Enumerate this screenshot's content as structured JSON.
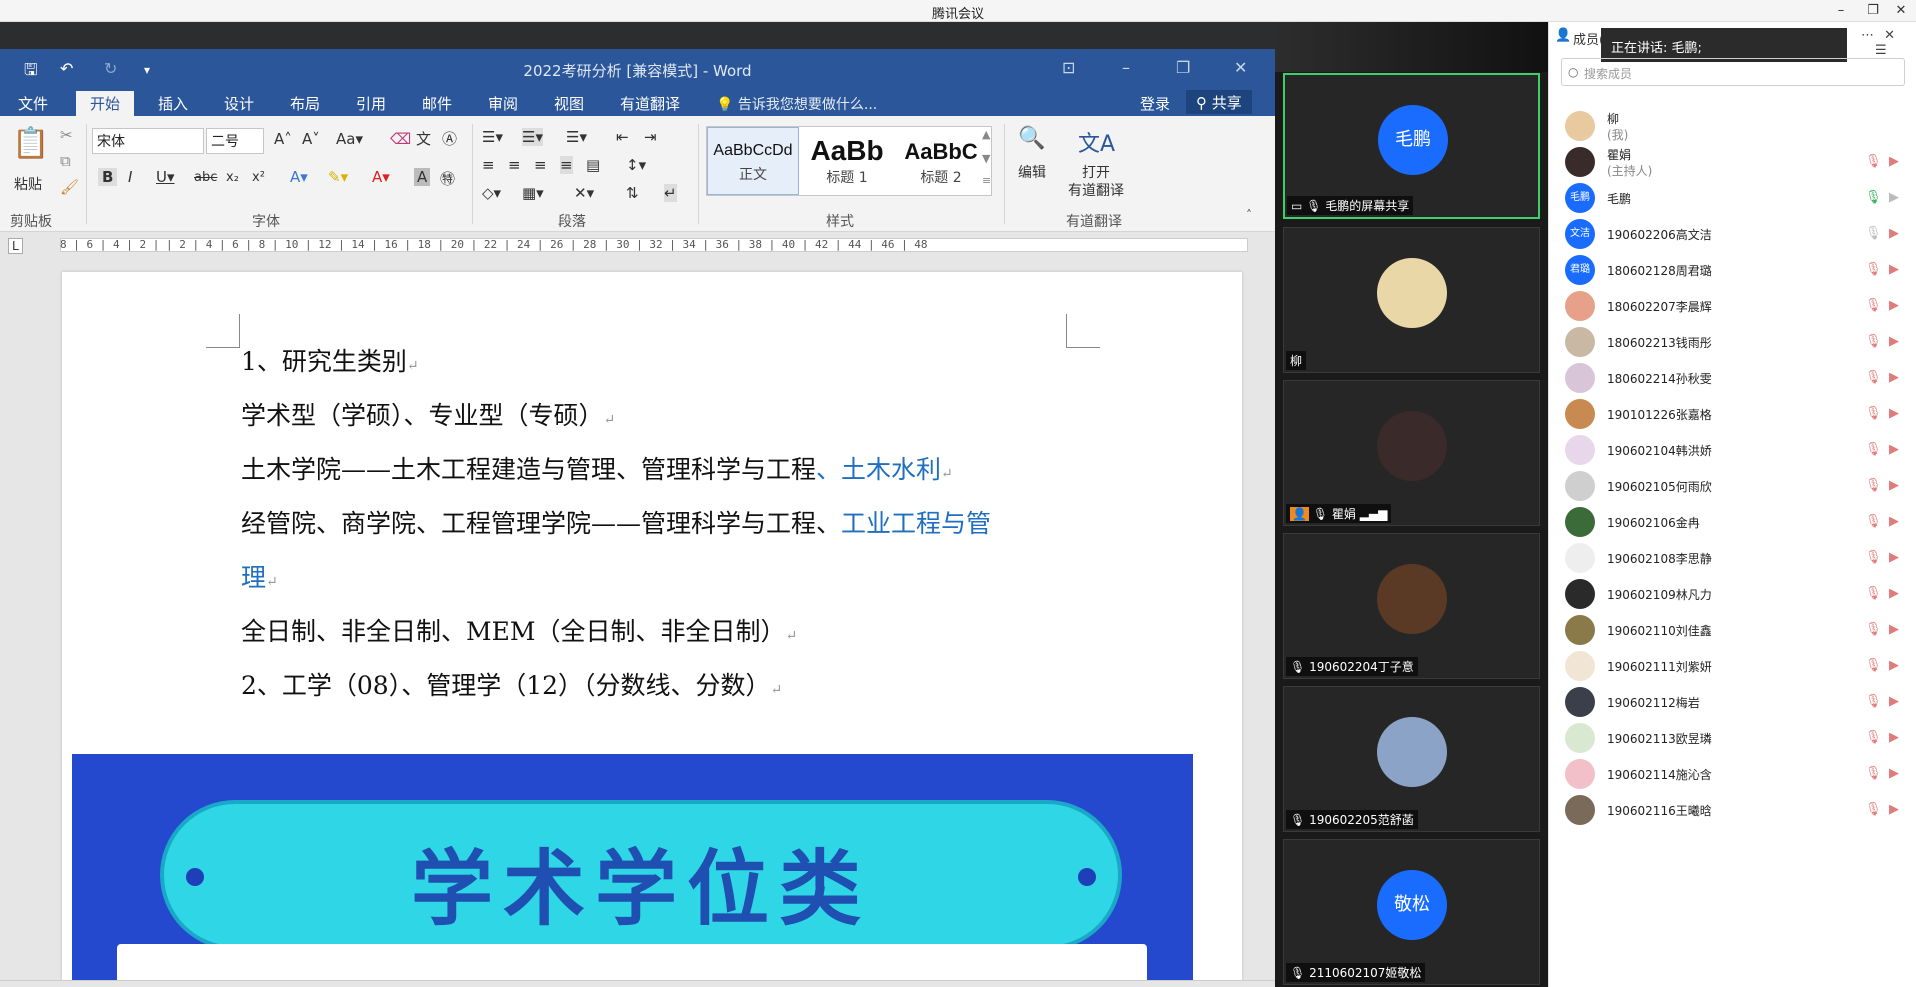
{
  "app": {
    "title": "腾讯会议",
    "min": "–",
    "restore": "❐",
    "close": "✕"
  },
  "word": {
    "doc_title": "2022考研分析 [兼容模式] - Word",
    "tabs": [
      "文件",
      "开始",
      "插入",
      "设计",
      "布局",
      "引用",
      "邮件",
      "审阅",
      "视图",
      "有道翻译"
    ],
    "tell_me": "告诉我您想要做什么...",
    "login": "登录",
    "share": "共享",
    "ribbon": {
      "paste": "粘贴",
      "font_name": "宋体",
      "font_size": "二号",
      "groups": [
        "剪贴板",
        "字体",
        "段落",
        "样式",
        "有道翻译"
      ],
      "styles": [
        {
          "preview": "AaBbCcDd",
          "label": "正文"
        },
        {
          "preview": "AaBb",
          "label": "标题 1"
        },
        {
          "preview": "AaBbC",
          "label": "标题 2"
        }
      ],
      "edit": "编辑",
      "open_translate_1": "打开",
      "open_translate_2": "有道翻译"
    },
    "ruler": "8 | 6 | 4 | 2 |   | 2 | 4 | 6 | 8 | 10 | 12 | 14 | 16 | 18 | 20 | 22 | 24 | 26 | 28 | 30 | 32 | 34 | 36 | 38 | 40 | 42 | 44 | 46 | 48",
    "paragraphs": [
      {
        "text": "1、研究生类别",
        "blue": ""
      },
      {
        "text": "学术型（学硕）、专业型（专硕）",
        "blue": ""
      },
      {
        "text": "土木学院——土木工程建造与管理、管理科学与工程",
        "blue": "、土木水利"
      },
      {
        "text": "经管院、商学院、工程管理学院——管理科学与工程、",
        "blue": "工业工程与管"
      },
      {
        "text": "",
        "blue": "理"
      },
      {
        "text": "全日制、非全日制、MEM（全日制、非全日制）",
        "blue": ""
      },
      {
        "text": "2、工学（08）、管理学（12）（分数线、分数）",
        "blue": ""
      }
    ],
    "paragraph_mark": "↵",
    "banner_text": "学术学位类"
  },
  "videos": [
    {
      "name": "毛鹏的屏幕共享",
      "avatar_text": "毛鹏",
      "color": "#1a6cff"
    },
    {
      "name": "柳",
      "avatar_text": "",
      "color": "#e9d7a8"
    },
    {
      "name": "瞿娟",
      "avatar_text": "",
      "color": "#3b2a2a"
    },
    {
      "name": "190602204丁子意",
      "avatar_text": "",
      "color": "#5a3a25"
    },
    {
      "name": "190602205范舒菡",
      "avatar_text": "",
      "color": "#8aa3c7"
    },
    {
      "name": "2110602107姬敬松",
      "avatar_text": "敬松",
      "color": "#1a6cff"
    }
  ],
  "members_panel": {
    "title": "成员(",
    "speaking": "正在讲话: 毛鹏;",
    "search_placeholder": "搜索成员",
    "members": [
      {
        "name": "柳",
        "role": "(我)",
        "avatar": "",
        "color": "#e8c9a0",
        "mic": "none"
      },
      {
        "name": "瞿娟",
        "role": "(主持人)",
        "avatar": "",
        "color": "#3a2b2b",
        "mic": "muted"
      },
      {
        "name": "毛鹏",
        "role": "",
        "avatar": "毛鹏",
        "color": "#1a6cff",
        "mic": "on"
      },
      {
        "name": "190602206高文洁",
        "role": "",
        "avatar": "文洁",
        "color": "#1a6cff",
        "mic": "gray"
      },
      {
        "name": "180602128周君璐",
        "role": "",
        "avatar": "君璐",
        "color": "#1a6cff",
        "mic": "muted"
      },
      {
        "name": "180602207李晨辉",
        "role": "",
        "avatar": "",
        "color": "#e7a08a",
        "mic": "muted"
      },
      {
        "name": "180602213钱雨彤",
        "role": "",
        "avatar": "",
        "color": "#c9b8a3",
        "mic": "muted"
      },
      {
        "name": "180602214孙秋雯",
        "role": "",
        "avatar": "",
        "color": "#d8c6d8",
        "mic": "muted"
      },
      {
        "name": "190101226张嘉格",
        "role": "",
        "avatar": "",
        "color": "#c98a52",
        "mic": "muted"
      },
      {
        "name": "190602104韩洪娇",
        "role": "",
        "avatar": "",
        "color": "#e8d6ea",
        "mic": "muted"
      },
      {
        "name": "190602105何雨欣",
        "role": "",
        "avatar": "",
        "color": "#cfcfcf",
        "mic": "muted"
      },
      {
        "name": "190602106金冉",
        "role": "",
        "avatar": "",
        "color": "#3c6b3a",
        "mic": "muted"
      },
      {
        "name": "190602108李思静",
        "role": "",
        "avatar": "",
        "color": "#eeeeee",
        "mic": "muted"
      },
      {
        "name": "190602109林凡力",
        "role": "",
        "avatar": "",
        "color": "#2a2a2a",
        "mic": "muted"
      },
      {
        "name": "190602110刘佳鑫",
        "role": "",
        "avatar": "",
        "color": "#8a7a4a",
        "mic": "muted"
      },
      {
        "name": "190602111刘紫妍",
        "role": "",
        "avatar": "",
        "color": "#f1e6d6",
        "mic": "muted"
      },
      {
        "name": "190602112梅岩",
        "role": "",
        "avatar": "",
        "color": "#3a3f4a",
        "mic": "muted"
      },
      {
        "name": "190602113欧昱璘",
        "role": "",
        "avatar": "",
        "color": "#d9e8d0",
        "mic": "muted"
      },
      {
        "name": "190602114施沁含",
        "role": "",
        "avatar": "",
        "color": "#f2c0c8",
        "mic": "muted"
      },
      {
        "name": "190602116王曦晗",
        "role": "",
        "avatar": "",
        "color": "#7a6a5a",
        "mic": "muted"
      }
    ]
  }
}
